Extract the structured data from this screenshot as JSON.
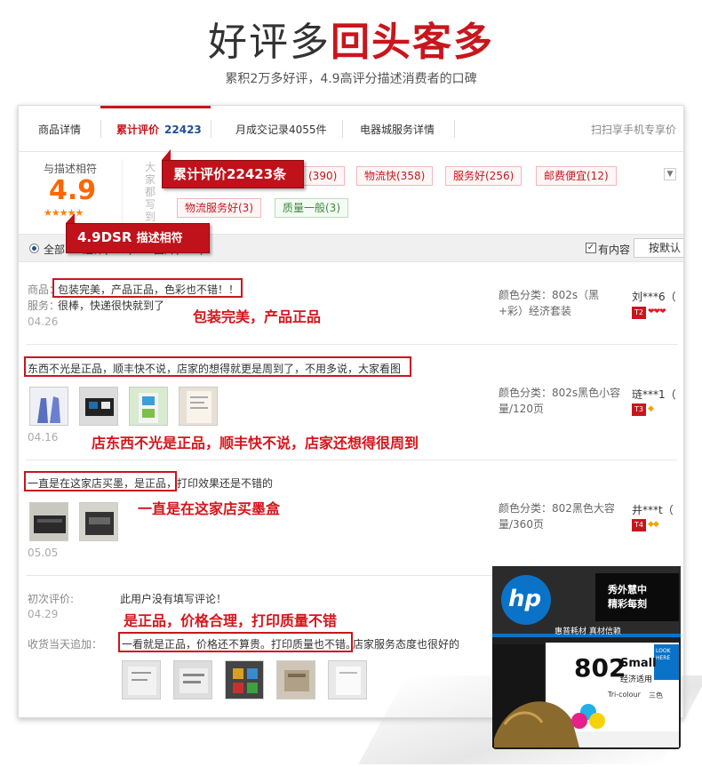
{
  "hero": {
    "title_plain": "好评多",
    "title_red": "回头客多",
    "subtitle": "累积2万多好评，4.9高评分描述消费者的口碑"
  },
  "tabs": {
    "items": [
      "商品详情",
      "累计评价",
      "月成交记录4055件",
      "电器城服务详情"
    ],
    "active_count": "22423",
    "scan": "扫扫享手机专享价"
  },
  "summary": {
    "rate_label": "与描述相符",
    "score": "4.9",
    "stars": "★★★★★",
    "vertical_hint": "大家都写到",
    "tags": [
      {
        "label": "物流快(358)",
        "type": "red"
      },
      {
        "label": "服务好(256)",
        "type": "red"
      },
      {
        "label": "邮费便宜(12)",
        "type": "red"
      },
      {
        "label": "物流服务好(3)",
        "type": "red"
      },
      {
        "label": "质量一般(3)",
        "type": "green"
      }
    ],
    "partial_tag": "(390)"
  },
  "callouts": {
    "total": "累计评价22423条",
    "dsr_main": "4.9DSR",
    "dsr_small": "描述相符"
  },
  "filter": {
    "all": "全部",
    "add": "追评(387)",
    "pic": "图片(103)",
    "has_content": "有内容",
    "sort": "按默认"
  },
  "reviews": [
    {
      "label_product": "商品：",
      "product_text": "包装完美，产品正品，色彩也不错！！",
      "label_service": "服务：",
      "service_text": "很棒，快递很快就到了",
      "date": "04.26",
      "annotation": "包装完美，产品正品",
      "spec": "颜色分类：802s（黑+彩）经济套装",
      "user": "刘***6（",
      "level": "T2"
    },
    {
      "text": "东西不光是正品，顺丰快不说，店家的想得就更是周到了，不用多说，大家看图",
      "date": "04.16",
      "annotation": "店东西不光是正品，顺丰快不说，店家还想得很周到",
      "spec": "颜色分类：802s黑色小容量/120页",
      "user": "琏***1（",
      "level": "T3"
    },
    {
      "text_boxed": "一直是在这家店买墨，是正品，",
      "text_rest": "打印效果还是不错的",
      "date": "05.05",
      "annotation": "一直是在这家店买墨盒",
      "spec": "颜色分类：802黑色大容量/360页",
      "user": "井***t（",
      "level": "T4"
    },
    {
      "label_initial": "初次评价:",
      "initial_text": "此用户没有填写评论！",
      "date": "04.29",
      "annotation": "是正品，价格合理，打印质量不错",
      "label_append": "收货当天追加：",
      "append_boxed": "一看就是正品，价格还不算贵。打印质量也不错。",
      "append_rest": "店家服务态度也很好的"
    }
  ],
  "product": {
    "brand": "hp",
    "badge_line1": "秀外慧中",
    "badge_line2": "精彩每刻",
    "strip": "惠普耗材 真材信赖",
    "model": "802",
    "model_small": "Small",
    "model_sub": "经济适用",
    "tri": "Tri-colour",
    "tri_cn": "三色",
    "side": "LOOK HERE"
  },
  "colors": {
    "accent_red": "#c8161d",
    "callout_red": "#c0121a",
    "score_orange": "#ff6600",
    "link_blue": "#1f4e96"
  }
}
